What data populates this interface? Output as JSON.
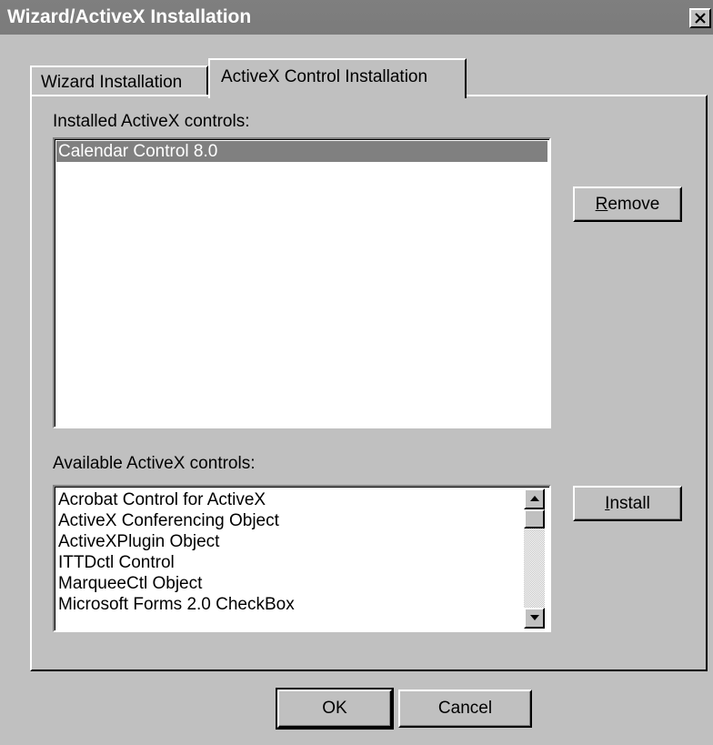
{
  "window": {
    "title": "Wizard/ActiveX Installation"
  },
  "tabs": [
    {
      "label": "Wizard Installation",
      "active": false
    },
    {
      "label": "ActiveX Control Installation",
      "active": true
    }
  ],
  "installed": {
    "label": "Installed ActiveX controls:",
    "items": [
      "Calendar Control 8.0"
    ],
    "selected": "Calendar Control 8.0"
  },
  "available": {
    "label": "Available ActiveX controls:",
    "items": [
      "Acrobat Control for ActiveX",
      "ActiveX Conferencing Object",
      "ActiveXPlugin Object",
      "ITTDctl Control",
      "MarqueeCtl Object",
      "Microsoft Forms 2.0 CheckBox"
    ]
  },
  "buttons": {
    "remove_access": "R",
    "remove_rest": "emove",
    "install_access": "I",
    "install_rest": "nstall",
    "ok": "OK",
    "cancel": "Cancel"
  },
  "icons": {
    "close": "close-icon",
    "scroll_up": "arrow-up-icon",
    "scroll_down": "arrow-down-icon"
  }
}
